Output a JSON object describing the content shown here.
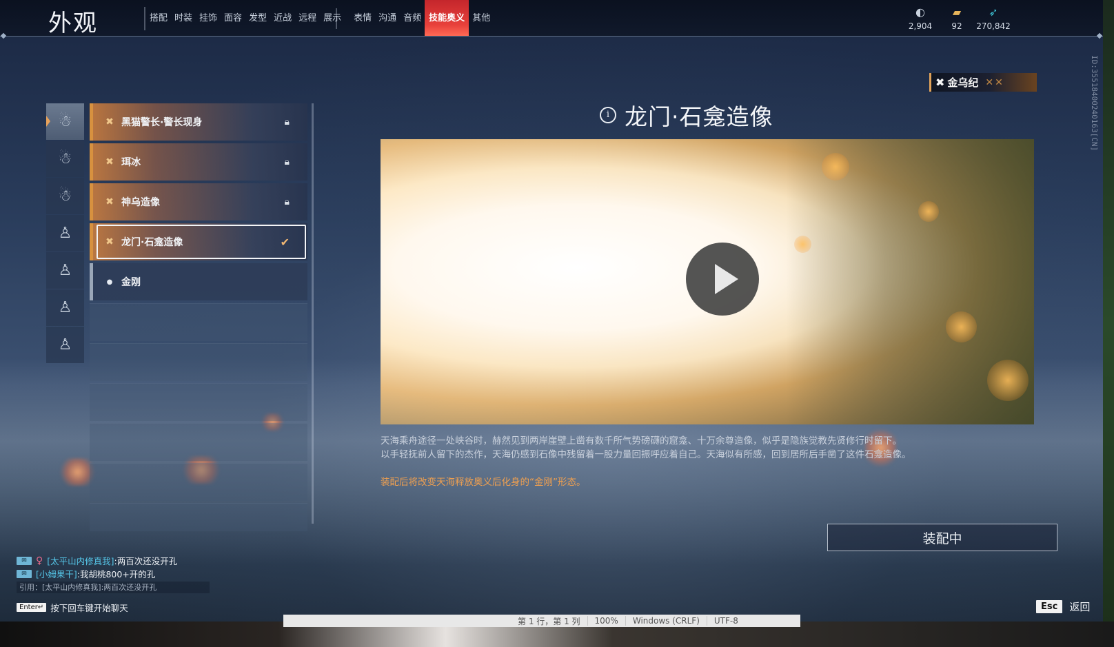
{
  "header": {
    "title": "外观",
    "tabs": [
      "搭配",
      "时装",
      "挂饰",
      "面容",
      "发型",
      "近战",
      "远程",
      "展示",
      "表情",
      "沟通",
      "音频",
      "技能奥义",
      "其他"
    ],
    "active_tab": "技能奥义",
    "currencies": [
      {
        "icon": "coin-icon",
        "value": "2,904"
      },
      {
        "icon": "ticket-icon",
        "value": "92"
      },
      {
        "icon": "feather-icon",
        "value": "270,842"
      }
    ]
  },
  "version": "ID:3551840024016З[CN]",
  "categories": [
    "cat-1",
    "cat-2",
    "cat-3",
    "cat-4",
    "cat-5",
    "cat-6",
    "cat-7"
  ],
  "list": {
    "items": [
      {
        "label": "黑猫警长·警长现身",
        "state": "locked"
      },
      {
        "label": "珥冰",
        "state": "locked"
      },
      {
        "label": "神乌造像",
        "state": "locked"
      },
      {
        "label": "龙门·石龛造像",
        "state": "equipped"
      },
      {
        "label": "金刚",
        "state": "default"
      }
    ]
  },
  "detail": {
    "era": "金乌纪",
    "title": "龙门·石龛造像",
    "description_line1": "天海乘舟途径一处峡谷时，赫然见到两岸崖壁上凿有数千所气势磅礴的窟龛、十万余尊造像，似乎是隐族觉教先贤修行时留下。",
    "description_line2": "以手轻抚前人留下的杰作，天海仍感到石像中残留着一股力量回振呼应着自己。天海似有所感，回到居所后手凿了这件石龛造像。",
    "note": "装配后将改变天海释放奥义后化身的“金刚”形态。",
    "equip_button": "装配中"
  },
  "chat": {
    "line1_name": "[太平山内修真我]",
    "line1_msg": ":两百次还没开孔",
    "line2_name": "[小姆果干]",
    "line2_msg": ":我胡桃800+开的孔",
    "quote": "引用：[太平山内修真我]:两百次还没开孔",
    "enter_key": "Enter↵",
    "enter_hint": "按下回车键开始聊天"
  },
  "esc": {
    "key": "Esc",
    "label": "返回"
  },
  "statusbar": [
    "第 1 行，第 1 列",
    "100%",
    "Windows (CRLF)",
    "UTF-8"
  ],
  "colors": {
    "accent": "#e8413b",
    "highlight": "#d7913f",
    "note": "#f0a050"
  }
}
